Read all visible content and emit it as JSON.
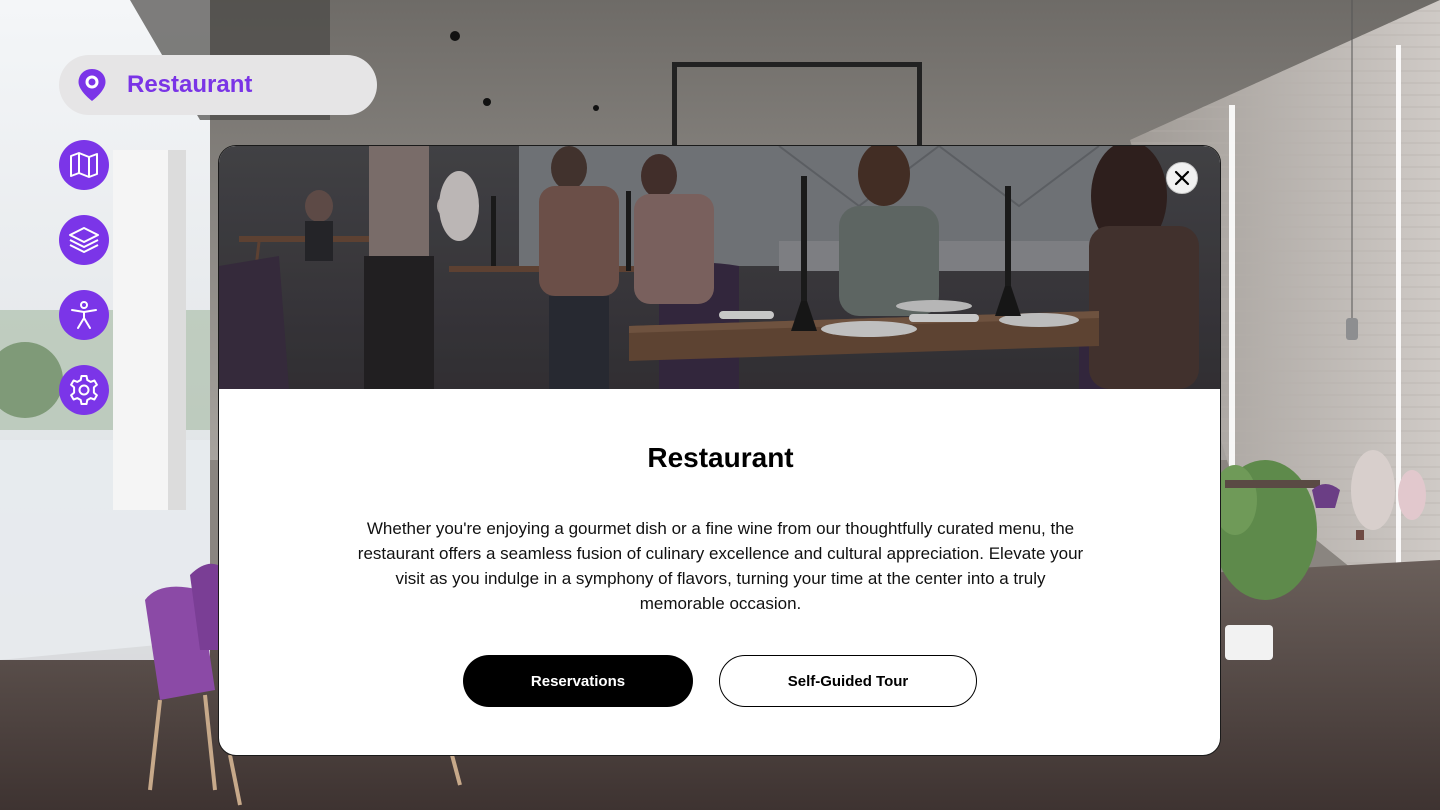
{
  "location": {
    "label": "Restaurant",
    "icon": "map-pin-icon"
  },
  "sidebar": {
    "buttons": [
      {
        "icon": "map-icon"
      },
      {
        "icon": "layers-icon"
      },
      {
        "icon": "accessibility-icon"
      },
      {
        "icon": "settings-icon"
      }
    ]
  },
  "modal": {
    "title": "Restaurant",
    "description": "Whether you're enjoying a gourmet dish or a fine wine from our thoughtfully curated menu, the restaurant offers a seamless fusion of culinary excellence and cultural appreciation. Elevate your visit as you indulge in a symphony of flavors, turning your time at the center into a truly memorable occasion.",
    "primary_button": "Reservations",
    "secondary_button": "Self-Guided Tour",
    "close_icon": "close-icon"
  },
  "colors": {
    "accent": "#7b35e8",
    "accent_text": "#7a34e6",
    "pill_background": "#e6e5e6",
    "primary_button": "#000000"
  }
}
